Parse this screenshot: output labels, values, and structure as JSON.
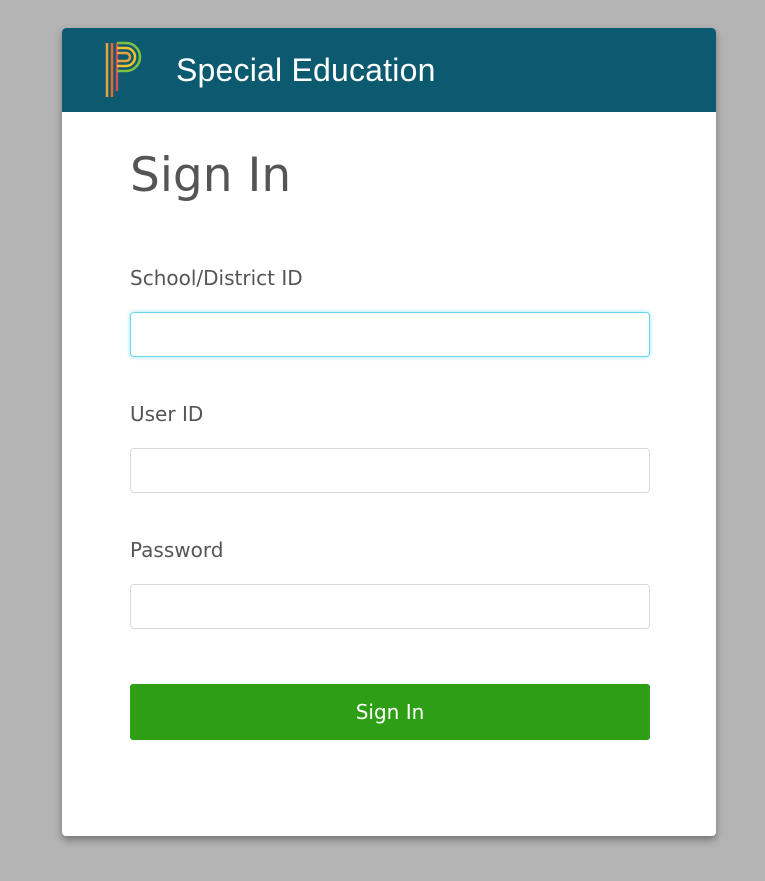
{
  "header": {
    "app_title": "Special Education",
    "brand_color": "#0b5a70",
    "logo": "powerschool-p-logo"
  },
  "form": {
    "title": "Sign In",
    "fields": {
      "school_id": {
        "label": "School/District ID",
        "value": "",
        "placeholder": ""
      },
      "user_id": {
        "label": "User ID",
        "value": "",
        "placeholder": ""
      },
      "password": {
        "label": "Password",
        "value": "",
        "placeholder": ""
      }
    },
    "submit_label": "Sign In",
    "submit_color": "#2e9e15",
    "focus_color": "#66d9ec"
  }
}
